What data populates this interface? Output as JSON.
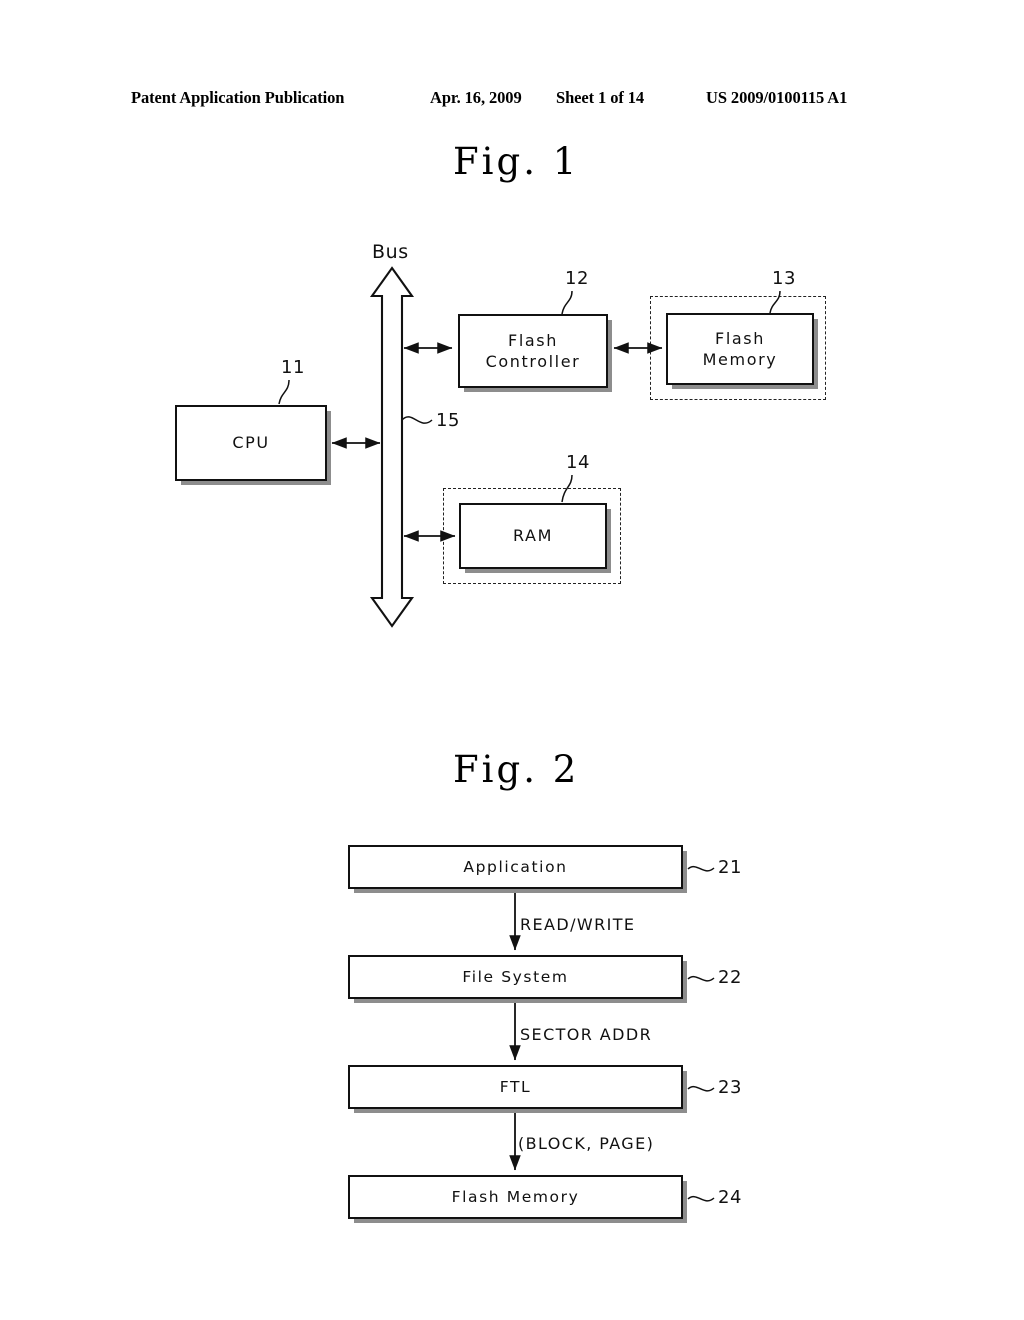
{
  "header": {
    "publication": "Patent Application Publication",
    "date": "Apr. 16, 2009",
    "sheet": "Sheet 1 of 14",
    "patent_number": "US 2009/0100115 A1"
  },
  "figures": [
    {
      "title": "Fig.  1",
      "caption_bus": "Bus",
      "blocks": [
        {
          "id": "cpu",
          "label": "CPU",
          "ref": "11",
          "dashed_enclosure": false
        },
        {
          "id": "flash-controller",
          "label": "Flash\nController",
          "ref": "12",
          "dashed_enclosure": false
        },
        {
          "id": "flash-memory",
          "label": "Flash\nMemory",
          "ref": "13",
          "dashed_enclosure": true
        },
        {
          "id": "ram",
          "label": "RAM",
          "ref": "14",
          "dashed_enclosure": true
        }
      ],
      "bus_ref": "15"
    },
    {
      "title": "Fig.  2",
      "blocks": [
        {
          "id": "application",
          "label": "Application",
          "ref": "21"
        },
        {
          "id": "file-system",
          "label": "File System",
          "ref": "22"
        },
        {
          "id": "ftl",
          "label": "FTL",
          "ref": "23"
        },
        {
          "id": "flash-memory",
          "label": "Flash Memory",
          "ref": "24"
        }
      ],
      "arrow_labels": [
        "READ/WRITE",
        "SECTOR ADDR",
        "(BLOCK,  PAGE)"
      ]
    }
  ],
  "colors": {
    "ink": "#111111",
    "shadow": "#8d8d8d",
    "paper": "#ffffff"
  }
}
